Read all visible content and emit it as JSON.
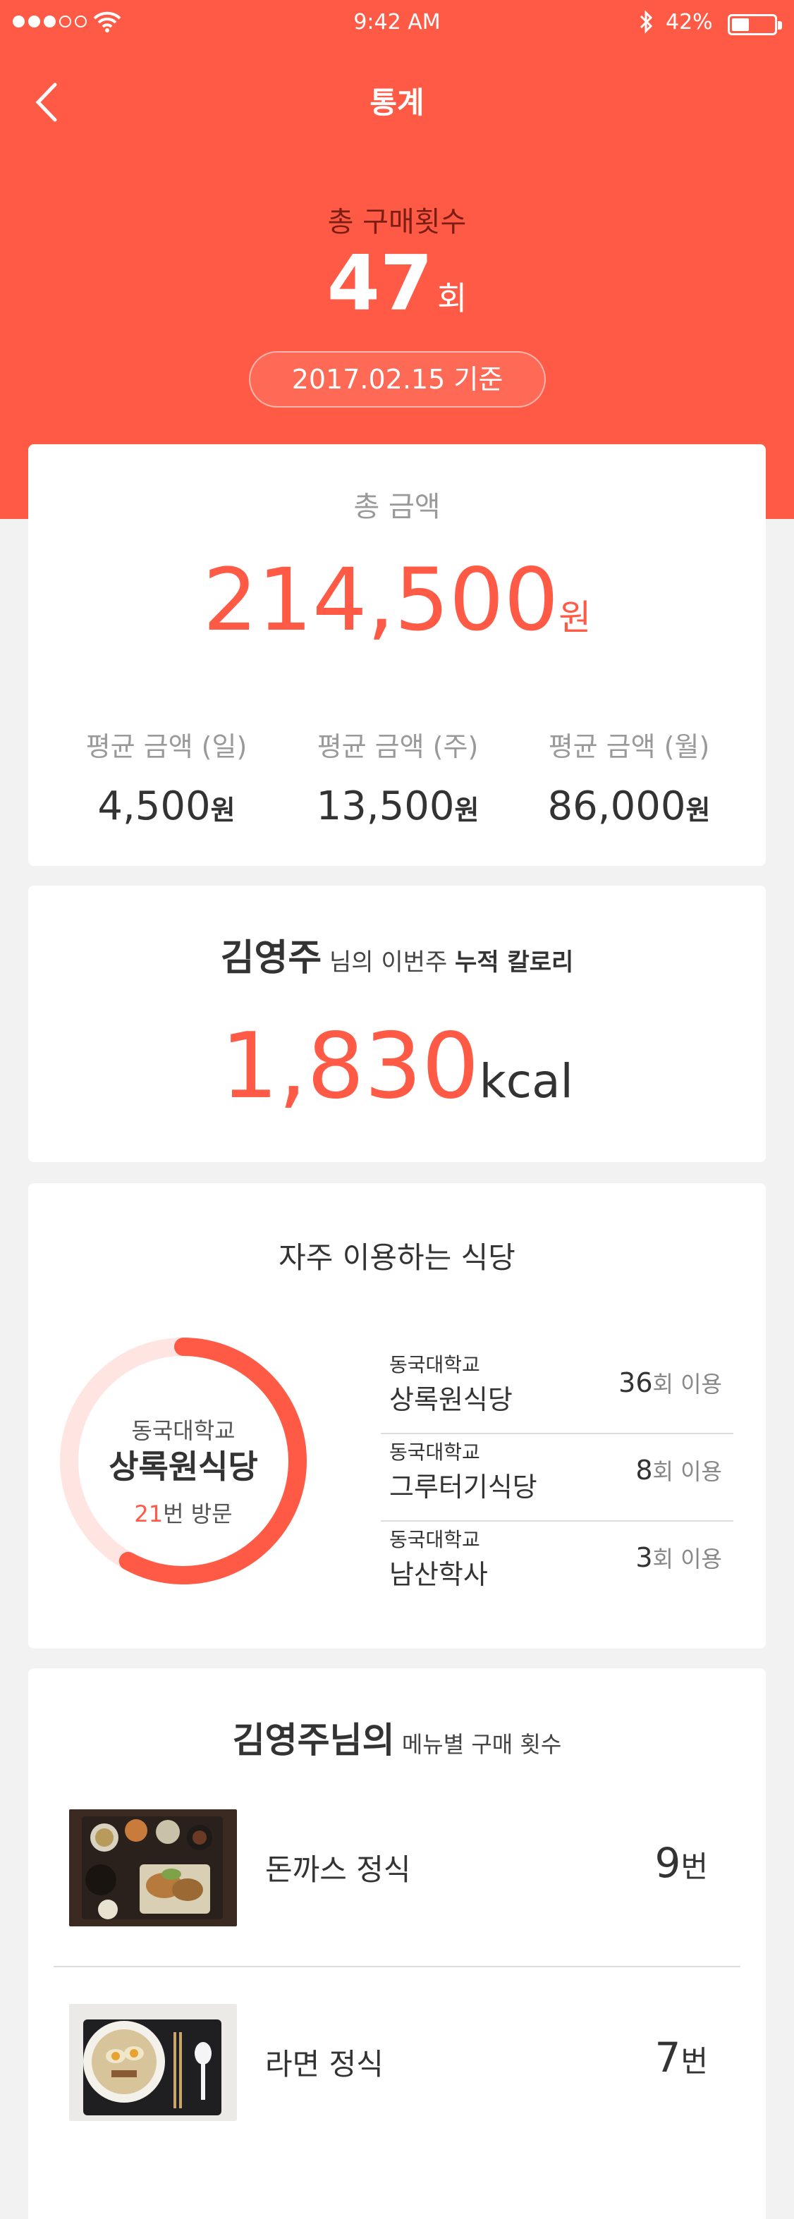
{
  "status": {
    "time": "9:42 AM",
    "battery": "42%",
    "battery_level": 0.42
  },
  "header": {
    "title": "통계",
    "total_count_label": "총 구매횟수",
    "total_count": "47",
    "total_count_unit": "회",
    "date_label": "2017.02.15 기준"
  },
  "amount_card": {
    "label": "총 금액",
    "total": "214,500",
    "unit": "원",
    "averages": [
      {
        "label": "평균 금액 (일)",
        "value": "4,500",
        "unit": "원"
      },
      {
        "label": "평균 금액 (주)",
        "value": "13,500",
        "unit": "원"
      },
      {
        "label": "평균 금액 (월)",
        "value": "86,000",
        "unit": "원"
      }
    ]
  },
  "calorie_card": {
    "user": "김영주",
    "text_mid": " 님의 이번주 ",
    "text_strong": "누적 칼로리",
    "value": "1,830",
    "unit": "kcal"
  },
  "restaurant_card": {
    "title": "자주 이용하는 식당",
    "ring": {
      "university": "동국대학교",
      "name": "상록원식당",
      "visits": "21",
      "visits_suffix": "번 방문",
      "progress": 0.58
    },
    "list": [
      {
        "university": "동국대학교",
        "name": "상록원식당",
        "count": "36",
        "unit": "회 이용"
      },
      {
        "university": "동국대학교",
        "name": "그루터기식당",
        "count": "8",
        "unit": "회 이용"
      },
      {
        "university": "동국대학교",
        "name": "남산학사",
        "count": "3",
        "unit": "회 이용"
      }
    ]
  },
  "menu_card": {
    "user": "김영주님의",
    "title_rest": " 메뉴별 구매 횟수",
    "items": [
      {
        "name": "돈까스 정식",
        "count": "9",
        "unit": "번"
      },
      {
        "name": "라면 정식",
        "count": "7",
        "unit": "번"
      }
    ]
  },
  "colors": {
    "accent": "#ff5a45",
    "ring_track": "#ffe5e2"
  }
}
